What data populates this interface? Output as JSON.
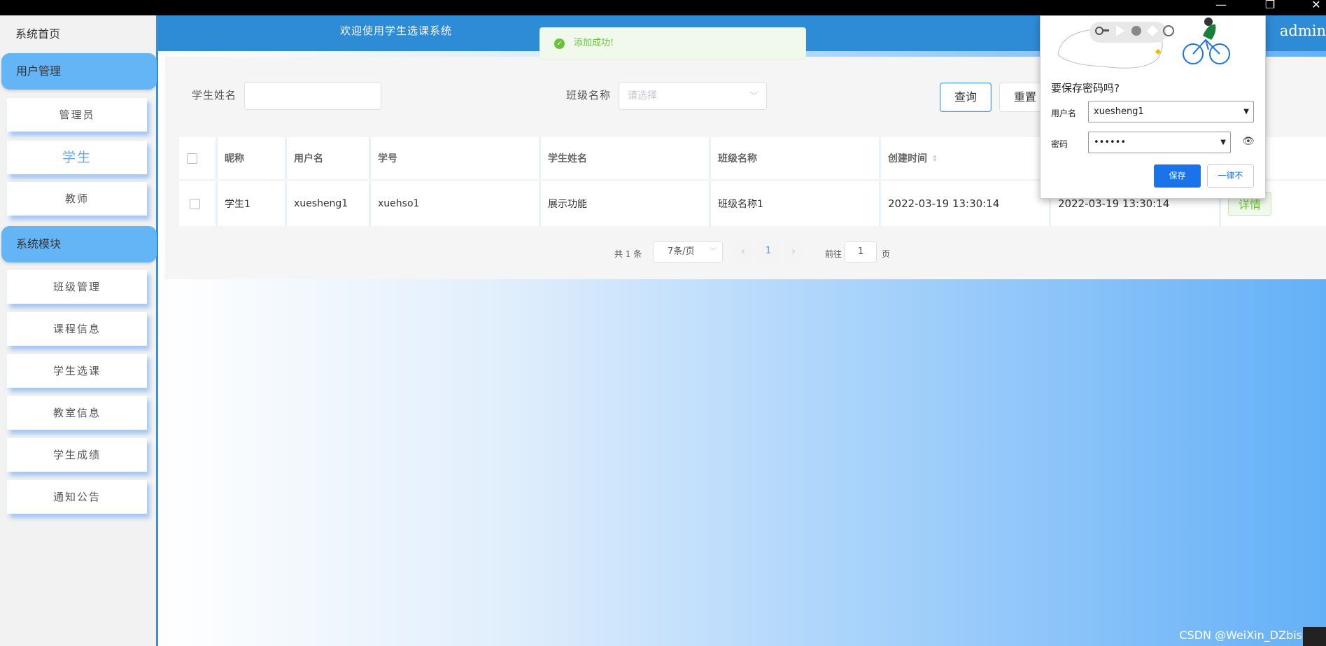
{
  "window": {
    "minimize": "—",
    "restore": "❐",
    "close": "✕"
  },
  "sidebar": {
    "home": "系统首页",
    "groups": [
      {
        "label": "用户管理",
        "items": [
          "管理员",
          "学生",
          "教师"
        ],
        "active": "学生"
      },
      {
        "label": "系统模块",
        "items": [
          "班级管理",
          "课程信息",
          "学生选课",
          "教室信息",
          "学生成绩",
          "通知公告"
        ]
      }
    ]
  },
  "header": {
    "welcome": "欢迎使用学生选课系统",
    "user": "admin"
  },
  "toast": {
    "message": "添加成功!"
  },
  "search": {
    "name_label": "学生姓名",
    "name_value": "",
    "class_label": "班级名称",
    "class_placeholder": "请选择",
    "query_btn": "查询",
    "reset_btn": "重置"
  },
  "table": {
    "headers": [
      "昵称",
      "用户名",
      "学号",
      "学生姓名",
      "班级名称",
      "创建时间"
    ],
    "sort_icon": "sort-icon",
    "rows": [
      {
        "nickname": "学生1",
        "username": "xuesheng1",
        "student_no": "xuehso1",
        "student_name": "展示功能",
        "class_name": "班级名称1",
        "created": "2022-03-19 13:30:14",
        "updated": "2022-03-19 13:30:14",
        "action": "详情"
      }
    ]
  },
  "pagination": {
    "total": "共 1 条",
    "page_size": "7条/页",
    "prev": "‹",
    "current": "1",
    "next": "›",
    "goto_label": "前往",
    "goto_value": "1",
    "page_unit": "页"
  },
  "password_popup": {
    "title": "要保存密码吗?",
    "username_label": "用户名",
    "username_value": "xuesheng1",
    "password_label": "密码",
    "password_value": "••••••",
    "save_btn": "保存",
    "never_btn": "一律不",
    "colors": {
      "save": "#1a73e8"
    }
  },
  "watermark": "CSDN @WeiXin_DZbishe"
}
